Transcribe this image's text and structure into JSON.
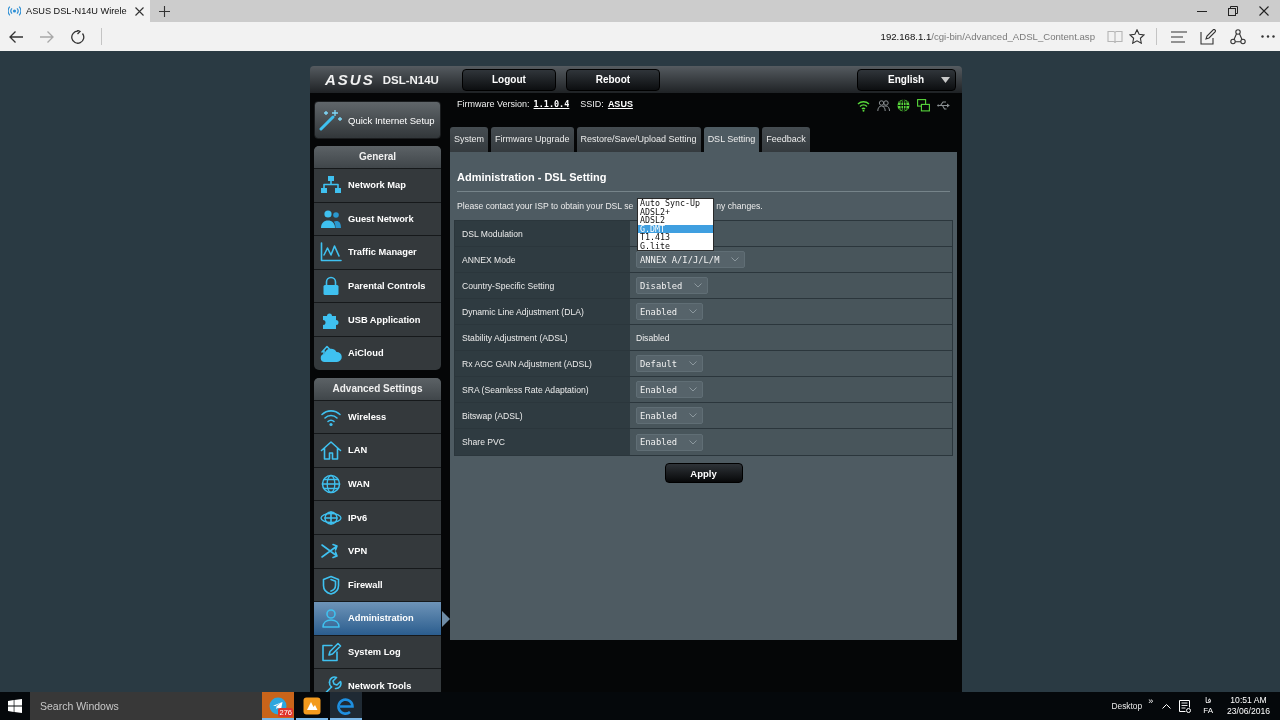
{
  "browser": {
    "tab_title": "ASUS DSL-N14U Wirele",
    "nav": [
      {
        "disabled": false
      },
      {
        "disabled": true
      },
      {
        "disabled": false
      }
    ],
    "address": {
      "host": "192.168.1.1",
      "path": "/cgi-bin/Advanced_ADSL_Content.asp"
    },
    "reading_view": {
      "disabled": true
    }
  },
  "router": {
    "logo": "ASUS",
    "model": "DSL-N14U",
    "header_buttons": [
      "Logout",
      "Reboot"
    ],
    "language": "English",
    "firmware_label": "Firmware Version:",
    "firmware_version": "1.1.0.4",
    "ssid_label": "SSID:",
    "ssid": "ASUS",
    "status_icons": [
      {
        "on": true
      },
      {
        "on": false
      },
      {
        "on": true
      },
      {
        "on": true
      },
      {
        "on": false
      }
    ],
    "quick_setup": "Quick Internet Setup",
    "menu": [
      {
        "title": "General",
        "items": [
          {
            "label": "Network Map",
            "selected": false
          },
          {
            "label": "Guest Network",
            "selected": false
          },
          {
            "label": "Traffic Manager",
            "selected": false
          },
          {
            "label": "Parental Controls",
            "selected": false
          },
          {
            "label": "USB Application",
            "selected": false
          },
          {
            "label": "AiCloud",
            "selected": false
          }
        ]
      },
      {
        "title": "Advanced Settings",
        "items": [
          {
            "label": "Wireless",
            "selected": false
          },
          {
            "label": "LAN",
            "selected": false
          },
          {
            "label": "WAN",
            "selected": false
          },
          {
            "label": "IPv6",
            "selected": false
          },
          {
            "label": "VPN",
            "selected": false
          },
          {
            "label": "Firewall",
            "selected": false
          },
          {
            "label": "Administration",
            "selected": true
          },
          {
            "label": "System Log",
            "selected": false
          },
          {
            "label": "Network Tools",
            "selected": false
          }
        ]
      }
    ],
    "tabs": [
      {
        "label": "System",
        "selected": false
      },
      {
        "label": "Firmware Upgrade",
        "selected": false
      },
      {
        "label": "Restore/Save/Upload Setting",
        "selected": false
      },
      {
        "label": "DSL Setting",
        "selected": true
      },
      {
        "label": "Feedback",
        "selected": false
      }
    ],
    "panel": {
      "title": "Administration - DSL Setting",
      "description": [
        "Please contact your ISP to obtain your DSL se",
        "ny changes."
      ],
      "settings": [
        {
          "label": "DSL Modulation",
          "kind": "select_open",
          "options": [
            {
              "label": "Auto Sync-Up",
              "selected": false
            },
            {
              "label": "ADSL2+",
              "selected": false
            },
            {
              "label": "ADSL2",
              "selected": false
            },
            {
              "label": "G.DMT",
              "selected": true
            },
            {
              "label": "T1.413",
              "selected": false
            },
            {
              "label": "G.lite",
              "selected": false
            }
          ]
        },
        {
          "label": "ANNEX Mode",
          "kind": "select",
          "value": "ANNEX A/I/J/L/M"
        },
        {
          "label": "Country-Specific Setting",
          "kind": "select",
          "value": "Disabled"
        },
        {
          "label": "Dynamic Line Adjustment (DLA)",
          "kind": "select",
          "value": "Enabled"
        },
        {
          "label": "Stability Adjustment (ADSL)",
          "kind": "text",
          "value": "Disabled"
        },
        {
          "label": "Rx AGC GAIN Adjustment (ADSL)",
          "kind": "select",
          "value": "Default"
        },
        {
          "label": "SRA (Seamless Rate Adaptation)",
          "kind": "select",
          "value": "Enabled"
        },
        {
          "label": "Bitswap (ADSL)",
          "kind": "select",
          "value": "Enabled"
        },
        {
          "label": "Share PVC",
          "kind": "select",
          "value": "Enabled"
        }
      ],
      "apply": "Apply"
    }
  },
  "taskbar": {
    "search_placeholder": "Search Windows",
    "apps": [
      {
        "badge": "276",
        "attention": true,
        "running": true,
        "active": false
      },
      {
        "attention": false,
        "running": true,
        "active": false
      },
      {
        "attention": false,
        "running": true,
        "active": true
      }
    ],
    "desktop_label": "Desktop",
    "more": "»",
    "input_script": "فا",
    "input_language": "FA",
    "time": "10:51 AM",
    "date": "23/06/2016"
  }
}
